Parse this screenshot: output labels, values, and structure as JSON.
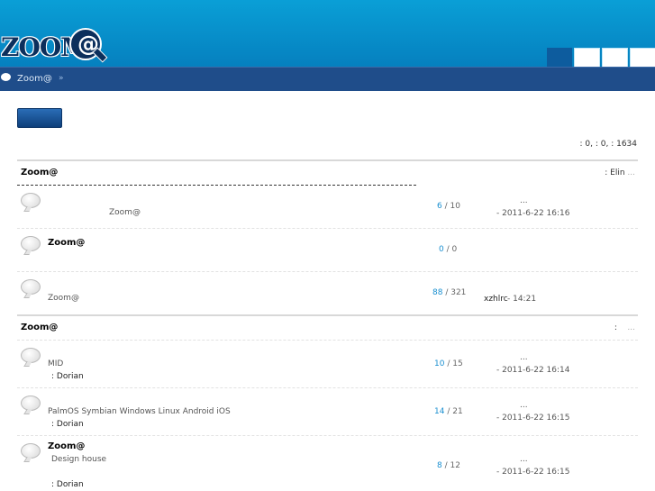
{
  "header": {
    "logo_text": "ZOOM",
    "logo_at": "@"
  },
  "navbar": {
    "breadcrumb": "Zoom@",
    "separator": "»"
  },
  "stats": ": 0,   : 0,   : 1634",
  "categories": [
    {
      "title": "Zoom@",
      "moderator": ": Elin",
      "moderator_extra": "...",
      "forums": [
        {
          "title": "",
          "description": "Zoom@",
          "posts": "6",
          "replies": "/ 10",
          "last_title": "...",
          "last_time": "- 2011-6-22 16:16"
        },
        {
          "title": "Zoom@",
          "description": "",
          "posts": "0",
          "replies": "/ 0",
          "last_title": "",
          "last_time": ""
        },
        {
          "title": "",
          "description": "Zoom@",
          "posts": "88",
          "replies": "/ 321",
          "last_user": "xzhlrc",
          "last_time": "-    14:21"
        }
      ]
    },
    {
      "title": "Zoom@",
      "moderator": ":",
      "moderator_extra": "...",
      "forums": [
        {
          "title": "",
          "description": "MID",
          "moderator": ": Dorian",
          "posts": "10",
          "replies": "/ 15",
          "last_title": "...",
          "last_time": "- 2011-6-22 16:14"
        },
        {
          "title": "",
          "description": "PalmOS Symbian Windows Linux Android iOS",
          "moderator": ": Dorian",
          "posts": "14",
          "replies": "/ 21",
          "last_title": "...",
          "last_time": "- 2011-6-22 16:15"
        },
        {
          "title": "Zoom@",
          "description": "Design house",
          "moderator": ": Dorian",
          "posts": "8",
          "replies": "/ 12",
          "last_title": "...",
          "last_time": "- 2011-6-22 16:15"
        }
      ]
    }
  ]
}
